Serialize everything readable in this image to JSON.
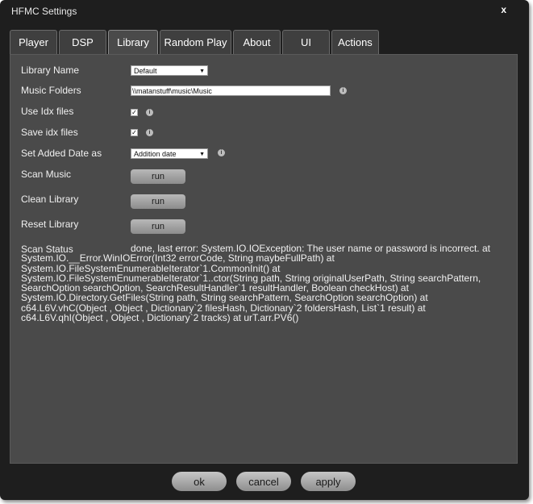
{
  "window": {
    "title": "HFMC Settings",
    "close_label": "x"
  },
  "tabs": [
    {
      "label": "Player",
      "active": false
    },
    {
      "label": "DSP",
      "active": false
    },
    {
      "label": "Library",
      "active": true
    },
    {
      "label": "Random Play",
      "active": false
    },
    {
      "label": "About",
      "active": false
    },
    {
      "label": "UI",
      "active": false
    },
    {
      "label": "Actions",
      "active": false
    }
  ],
  "library": {
    "library_name": {
      "label": "Library Name",
      "value": "Default"
    },
    "music_folders": {
      "label": "Music Folders",
      "value": "\\\\matanstuff\\music\\Music"
    },
    "use_idx": {
      "label": "Use Idx files",
      "checked": true
    },
    "save_idx": {
      "label": "Save idx files",
      "checked": true
    },
    "added_date": {
      "label": "Set Added Date as",
      "value": "Addition date"
    },
    "scan_music": {
      "label": "Scan Music",
      "button": "run"
    },
    "clean_library": {
      "label": "Clean Library",
      "button": "run"
    },
    "reset_library": {
      "label": "Reset Library",
      "button": "run"
    },
    "scan_status": {
      "label": "Scan Status",
      "text": "done, last error: System.IO.IOException: The user name or password is incorrect.  at System.IO.__Error.WinIOError(Int32 errorCode, String maybeFullPath) at System.IO.FileSystemEnumerableIterator`1.CommonInit() at System.IO.FileSystemEnumerableIterator`1..ctor(String path, String originalUserPath, String searchPattern, SearchOption searchOption, SearchResultHandler`1 resultHandler, Boolean checkHost) at System.IO.Directory.GetFiles(String path, String searchPattern, SearchOption searchOption) at c64.L6V.vhC(Object , Object , Dictionary`2 filesHash, Dictionary`2 foldersHash, List`1 result) at c64.L6V.qhI(Object , Object , Dictionary`2 tracks) at urT.arr.PV6()"
    }
  },
  "footer": {
    "ok": "ok",
    "cancel": "cancel",
    "apply": "apply"
  },
  "icons": {
    "info": "info-icon",
    "checkmark": "checkmark-icon",
    "dropdown": "chevron-down-icon"
  },
  "colors": {
    "window_bg": "#1e1e1e",
    "panel_bg": "#4a4a4a",
    "tab_bg": "#3f3f3f",
    "button_bg": "#a8a8a8"
  }
}
